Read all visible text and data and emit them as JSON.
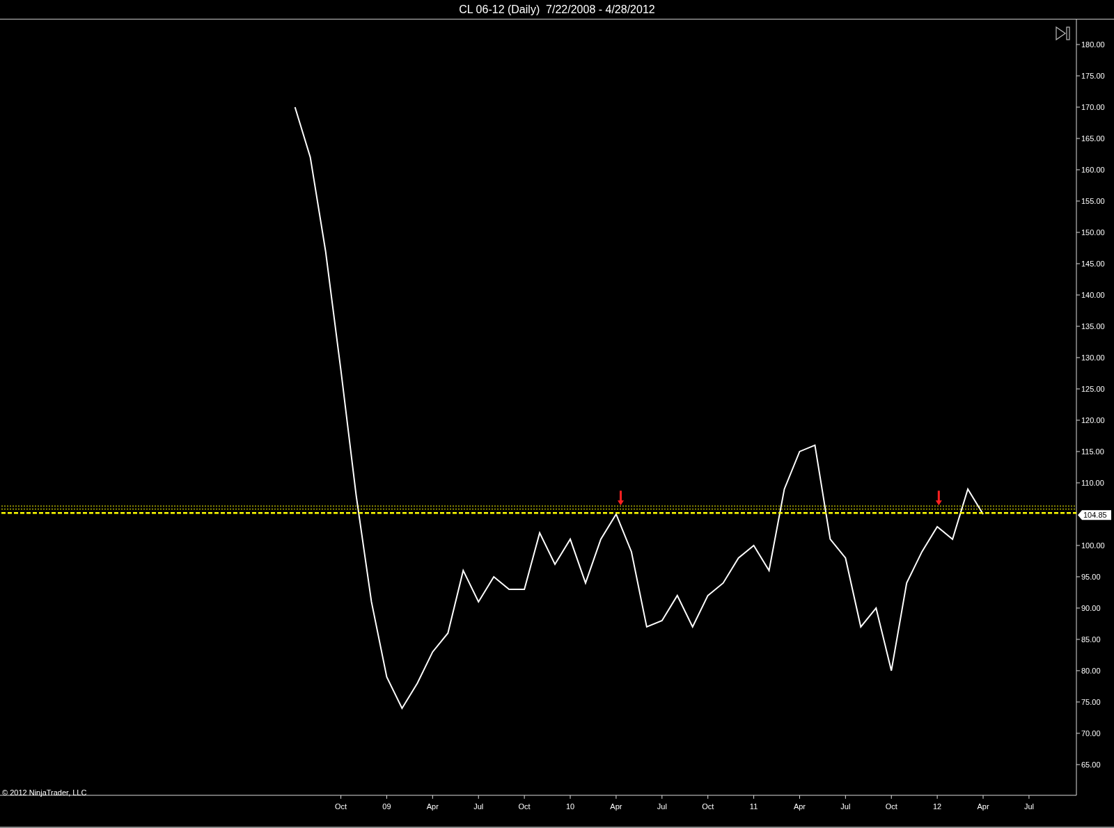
{
  "title": "CL 06-12 (Daily)  7/22/2008 - 4/28/2012",
  "copyright": "© 2012 NinjaTrader, LLC",
  "price_label": "104.85",
  "chart_data": {
    "type": "line",
    "ylim": [
      60.1,
      184
    ],
    "categories": [
      null,
      null,
      null,
      "Oct",
      null,
      null,
      "09",
      null,
      null,
      "Apr",
      null,
      null,
      "Jul",
      null,
      null,
      "Oct",
      null,
      null,
      "10",
      null,
      null,
      "Apr",
      null,
      null,
      "Jul",
      null,
      null,
      "Oct",
      null,
      null,
      "11",
      null,
      null,
      "Apr",
      null,
      null,
      "Jul",
      null,
      null,
      "Oct",
      null,
      null,
      "12",
      null,
      null,
      "Apr",
      null,
      null,
      "Jul"
    ],
    "series": [
      {
        "color": "#ffffff",
        "values": [
          170,
          162,
          147,
          128,
          108,
          91,
          79,
          74,
          78,
          83,
          86,
          96,
          91,
          95,
          93,
          93,
          102,
          97,
          101,
          94,
          101,
          105,
          99,
          87,
          88,
          92,
          87,
          92,
          94,
          98,
          100,
          96,
          109,
          115,
          116,
          101,
          98,
          87,
          90,
          80,
          94,
          99,
          103,
          101,
          109,
          105,
          null,
          null,
          null
        ]
      },
      {
        "color": "#ffff00",
        "line_style": "dotted",
        "values": [
          106.3,
          106.3,
          106.3,
          106.3,
          106.3,
          106.3,
          106.3,
          106.3,
          106.3,
          106.3,
          106.3,
          106.3,
          106.3,
          106.3,
          106.3,
          106.3,
          106.3,
          106.3,
          106.3,
          106.3,
          106.3,
          106.3,
          106.3,
          106.3,
          106.3,
          106.3,
          106.3,
          106.3,
          106.3,
          106.3,
          106.3,
          106.3,
          106.3,
          106.3,
          106.3,
          106.3,
          106.3,
          106.3,
          106.3,
          106.3,
          106.3,
          106.3,
          106.3,
          106.3,
          106.3,
          106.3,
          106.3,
          106.3,
          106.3
        ]
      },
      {
        "color": "#ffff00",
        "line_style": "dotted",
        "values": [
          105.8,
          105.8,
          105.8,
          105.8,
          105.8,
          105.8,
          105.8,
          105.8,
          105.8,
          105.8,
          105.8,
          105.8,
          105.8,
          105.8,
          105.8,
          105.8,
          105.8,
          105.8,
          105.8,
          105.8,
          105.8,
          105.8,
          105.8,
          105.8,
          105.8,
          105.8,
          105.8,
          105.8,
          105.8,
          105.8,
          105.8,
          105.8,
          105.8,
          105.8,
          105.8,
          105.8,
          105.8,
          105.8,
          105.8,
          105.8,
          105.8,
          105.8,
          105.8,
          105.8,
          105.8,
          105.8,
          105.8,
          105.8,
          105.8
        ]
      },
      {
        "color": "#ffff00",
        "line_style": "dashed",
        "values": [
          105.2,
          105.2,
          105.2,
          105.2,
          105.2,
          105.2,
          105.2,
          105.2,
          105.2,
          105.2,
          105.2,
          105.2,
          105.2,
          105.2,
          105.2,
          105.2,
          105.2,
          105.2,
          105.2,
          105.2,
          105.2,
          105.2,
          105.2,
          105.2,
          105.2,
          105.2,
          105.2,
          105.2,
          105.2,
          105.2,
          105.2,
          105.2,
          105.2,
          105.2,
          105.2,
          105.2,
          105.2,
          105.2,
          105.2,
          105.2,
          105.2,
          105.2,
          105.2,
          105.2,
          105.2,
          105.2,
          105.2,
          105.2,
          105.2
        ]
      }
    ],
    "yticks": [
      {
        "value": 65,
        "label": "65.00"
      },
      {
        "value": 70,
        "label": "70.00"
      },
      {
        "value": 75,
        "label": "75.00"
      },
      {
        "value": 80,
        "label": "80.00"
      },
      {
        "value": 85,
        "label": "85.00"
      },
      {
        "value": 90,
        "label": "90.00"
      },
      {
        "value": 95,
        "label": "95.00"
      },
      {
        "value": 100,
        "label": "100.00"
      },
      {
        "value": 110,
        "label": "110.00"
      },
      {
        "value": 115,
        "label": "115.00"
      },
      {
        "value": 120,
        "label": "120.00"
      },
      {
        "value": 125,
        "label": "125.00"
      },
      {
        "value": 130,
        "label": "130.00"
      },
      {
        "value": 135,
        "label": "135.00"
      },
      {
        "value": 140,
        "label": "140.00"
      },
      {
        "value": 145,
        "label": "145.00"
      },
      {
        "value": 150,
        "label": "150.00"
      },
      {
        "value": 155,
        "label": "155.00"
      },
      {
        "value": 160,
        "label": "160.00"
      },
      {
        "value": 165,
        "label": "165.00"
      },
      {
        "value": 170,
        "label": "170.00"
      },
      {
        "value": 175,
        "label": "175.00"
      },
      {
        "value": 180,
        "label": "180.00"
      }
    ]
  }
}
